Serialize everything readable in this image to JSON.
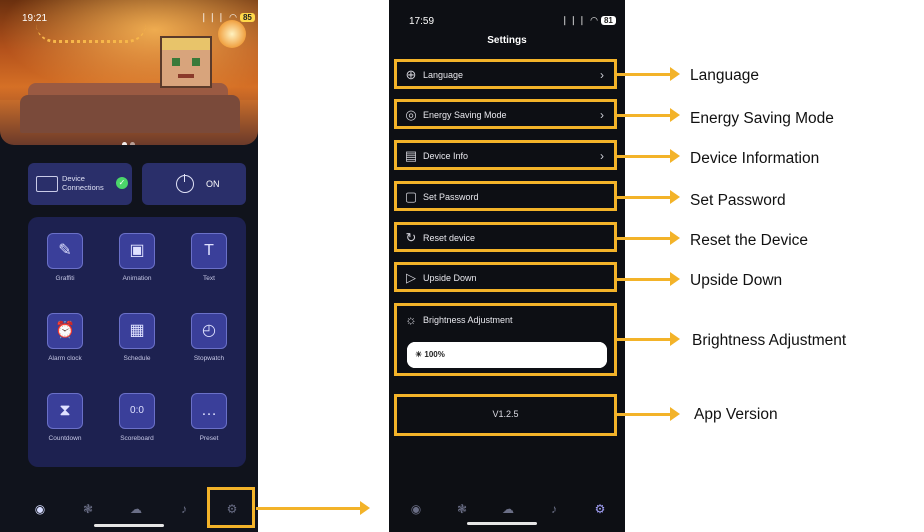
{
  "left_phone": {
    "status_time": "19:21",
    "status_icons": "❘❘❘ ◠",
    "battery": "85",
    "device_connections_label": "Device Connections",
    "power_label": "ON",
    "tiles": [
      {
        "label": "Graffiti",
        "icon": "graffiti-icon",
        "glyph": "✎"
      },
      {
        "label": "Animation",
        "icon": "animation-icon",
        "glyph": "▣"
      },
      {
        "label": "Text",
        "icon": "text-icon",
        "glyph": "T"
      },
      {
        "label": "Alarm clock",
        "icon": "alarm-clock-icon",
        "glyph": "⏰"
      },
      {
        "label": "Schedule",
        "icon": "schedule-icon",
        "glyph": "▦"
      },
      {
        "label": "Stopwatch",
        "icon": "stopwatch-icon",
        "glyph": "◴"
      },
      {
        "label": "Countdown",
        "icon": "countdown-icon",
        "glyph": "⧗"
      },
      {
        "label": "Scoreboard",
        "icon": "scoreboard-icon",
        "glyph": "0:0"
      },
      {
        "label": "Preset",
        "icon": "preset-icon",
        "glyph": "…"
      }
    ],
    "nav": [
      {
        "icon": "compass-icon",
        "glyph": "◉",
        "active": true
      },
      {
        "icon": "shapes-icon",
        "glyph": "❃",
        "active": false
      },
      {
        "icon": "cloud-icon",
        "glyph": "☁",
        "active": false
      },
      {
        "icon": "music-icon",
        "glyph": "♪",
        "active": false
      },
      {
        "icon": "settings-gear-icon",
        "glyph": "⚙",
        "active": false
      }
    ]
  },
  "right_phone": {
    "status_time": "17:59",
    "status_icons": "❘❘❘ ◠",
    "battery": "81",
    "title": "Settings",
    "rows": [
      {
        "label": "Language",
        "icon": "globe-icon",
        "glyph": "⊕",
        "chevron": true
      },
      {
        "label": "Energy Saving Mode",
        "icon": "bulb-icon",
        "glyph": "◎",
        "chevron": true
      },
      {
        "label": "Device Info",
        "icon": "device-info-icon",
        "glyph": "▤",
        "chevron": true
      },
      {
        "label": "Set Password",
        "icon": "lock-icon",
        "glyph": "▢",
        "chevron": false
      },
      {
        "label": "Reset device",
        "icon": "reset-icon",
        "glyph": "↻",
        "chevron": false
      },
      {
        "label": "Upside Down",
        "icon": "flip-icon",
        "glyph": "▷",
        "chevron": false
      }
    ],
    "brightness_label": "Brightness Adjustment",
    "brightness_value": "100%",
    "brightness_level": 1.0,
    "version": "V1.2.5",
    "chevron_glyph": "›",
    "nav": [
      {
        "icon": "compass-icon",
        "glyph": "◉",
        "active": false
      },
      {
        "icon": "shapes-icon",
        "glyph": "❃",
        "active": false
      },
      {
        "icon": "cloud-icon",
        "glyph": "☁",
        "active": false
      },
      {
        "icon": "music-icon",
        "glyph": "♪",
        "active": false
      },
      {
        "icon": "settings-gear-icon",
        "glyph": "⚙",
        "active": true
      }
    ]
  },
  "callouts": [
    "Language",
    "Energy Saving Mode",
    "Device Information",
    "Set Password",
    "Reset the Device",
    "Upside Down",
    "Brightness Adjustment",
    "App Version"
  ],
  "colors": {
    "accent": "#f3b329",
    "tile_bg": "#3a3f9a",
    "panel_bg": "#1d2150",
    "check": "#4bd66a"
  }
}
